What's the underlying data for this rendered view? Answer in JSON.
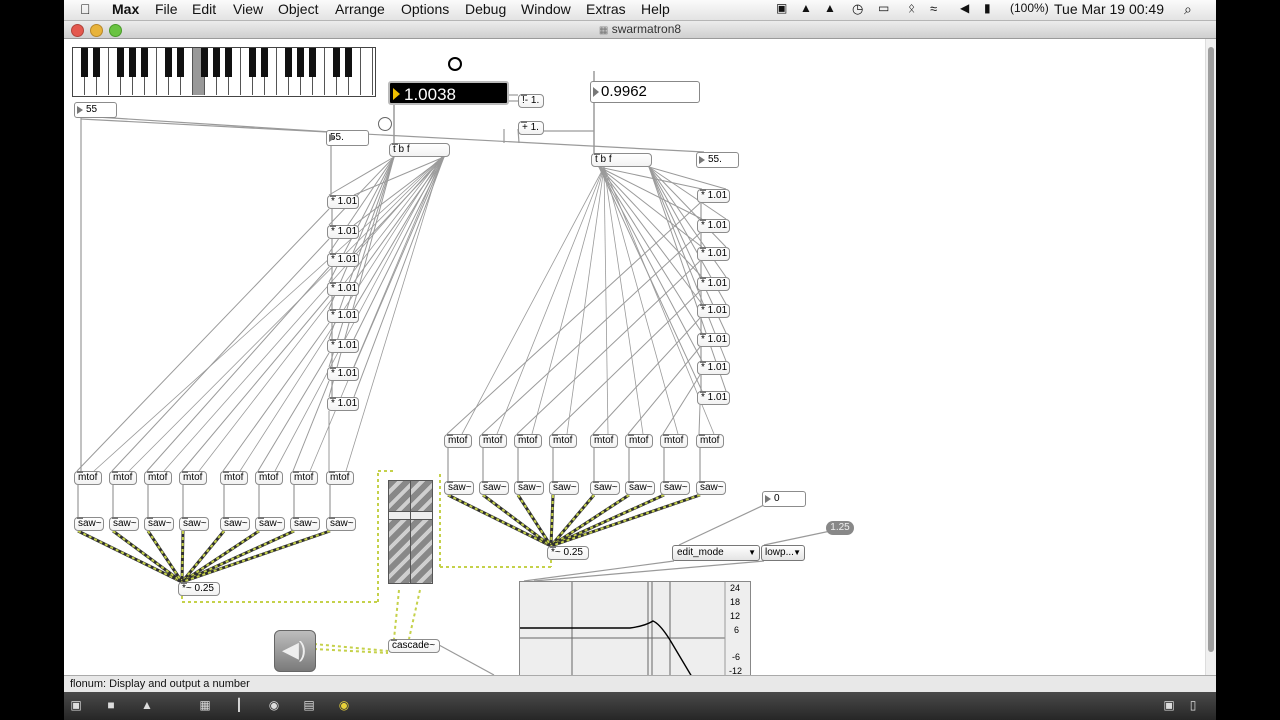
{
  "menubar": {
    "apple_icon": "apple-icon",
    "app": "Max",
    "items": [
      "File",
      "Edit",
      "View",
      "Object",
      "Arrange",
      "Options",
      "Debug",
      "Window",
      "Extras",
      "Help"
    ],
    "battery": "(100%)",
    "clock": "Tue Mar 19  00:49"
  },
  "window": {
    "title": "swarmatron8"
  },
  "patch": {
    "left_number": "55",
    "left_number_float": "55.",
    "right_number_float": "55.",
    "flonum_main": "1.0038",
    "flonum_inverse": "0.9962",
    "op_minus": "!- 1.",
    "op_plus": "+ 1.",
    "trigger_left": "t b f",
    "trigger_right": "t b f",
    "mult_label": "* 1.01",
    "mtof_label": "mtof",
    "saw_label": "saw~",
    "mix_left": "*~ 0.25",
    "mix_right": "*~ 0.25",
    "cascade": "cascade~",
    "zero_number": "0",
    "edit_mode": "edit_mode",
    "filter_type": "lowp...",
    "q_value": "1.25",
    "graph_db_labels": [
      "24",
      "18",
      "12",
      "6",
      "-6",
      "-12"
    ]
  },
  "status": {
    "text": "flonum: Display and output a number"
  }
}
